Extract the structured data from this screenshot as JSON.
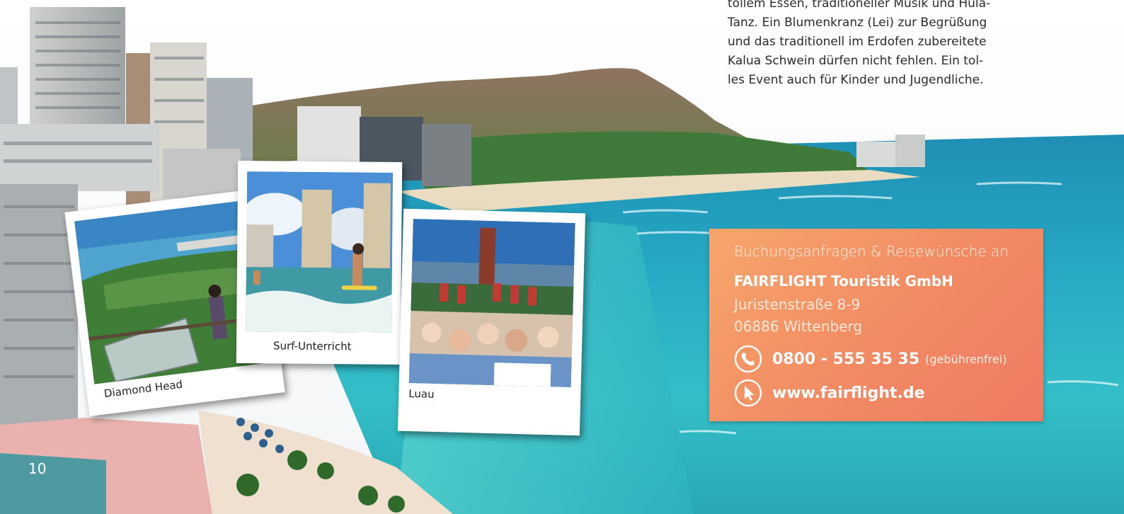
{
  "intro": {
    "lines": [
      "tollem Essen, traditioneller Musik und Hula-",
      "Tanz. Ein Blumenkranz (Lei) zur Begrüßung",
      "und das traditionell im Erdofen zubereitete",
      "Kalua Schwein dürfen nicht fehlen. Ein tol-",
      "les Event auch für Kinder und Jugendliche."
    ]
  },
  "photos": {
    "diamond_head": "Diamond Head",
    "surf": "Surf-Unterricht",
    "luau": "Luau"
  },
  "contact": {
    "heading": "Buchungsanfragen & Reisewünsche an",
    "company": "FAIRFLIGHT Touristik GmbH",
    "street": "Juristenstraße 8-9",
    "city": "06886 Wittenberg",
    "phone": "0800 - 555 35 35",
    "phone_note": "(gebührenfrei)",
    "website": "www.fairflight.de",
    "phone_icon": "phone-icon",
    "web_icon": "cursor-icon",
    "box_color": "#f28a63"
  },
  "page_number": "10"
}
